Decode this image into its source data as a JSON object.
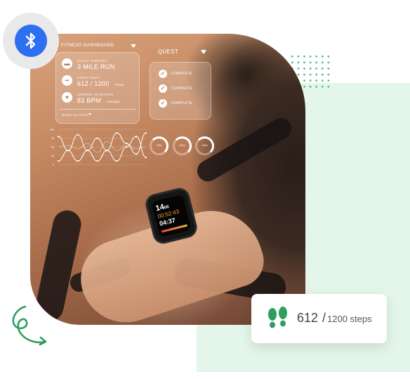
{
  "dashboard": {
    "title": "FITNESS DASHBOARD",
    "stats": [
      {
        "label": "SELECT WORKOUT",
        "value": "3 MILE RUN",
        "unit": "",
        "icon": "dumbbell-icon"
      },
      {
        "label": "STEPS TODAY",
        "value": "612 / 1200",
        "unit": "Steps",
        "icon": "footsteps-icon"
      },
      {
        "label": "CURRENT HEARTRATE",
        "value": "83 BPM",
        "unit": "Average",
        "icon": "heart-icon"
      }
    ],
    "playlist_label": "MUSIC PLAYLIST"
  },
  "quest": {
    "title": "QUEST",
    "items": [
      "COMPLETE",
      "COMPLETE",
      "COMPLETE"
    ]
  },
  "chart_data": {
    "type": "line",
    "ylabels": [
      "100",
      "75",
      "50",
      "25",
      "0"
    ],
    "ylim": [
      0,
      100
    ],
    "series": [
      {
        "values": [
          10,
          40,
          85,
          40,
          10,
          40,
          90,
          60,
          30,
          90
        ]
      },
      {
        "values": [
          80,
          40,
          10,
          40,
          75,
          40,
          10,
          50,
          80,
          20
        ]
      },
      {
        "values": [
          50,
          55,
          45,
          60,
          35,
          65,
          40,
          55,
          45,
          50
        ]
      }
    ]
  },
  "progress_rings": [
    {
      "label": "75%",
      "value": 0.75
    },
    {
      "label": "50%",
      "value": 0.5
    },
    {
      "label": "25%",
      "value": 0.25
    }
  ],
  "watch": {
    "time": "14",
    "time_suffix": "06",
    "line2": "00:52:43",
    "line3": "04:37"
  },
  "step_card": {
    "steps": "612",
    "slash": "/",
    "goal": "1200 steps"
  },
  "colors": {
    "bluetooth": "#2d6ff0",
    "accent_green": "#2f9e5e",
    "mint_bg": "#e4f6ea"
  },
  "icons": {
    "bluetooth": "bluetooth-icon",
    "footprints": "footprints-icon"
  }
}
